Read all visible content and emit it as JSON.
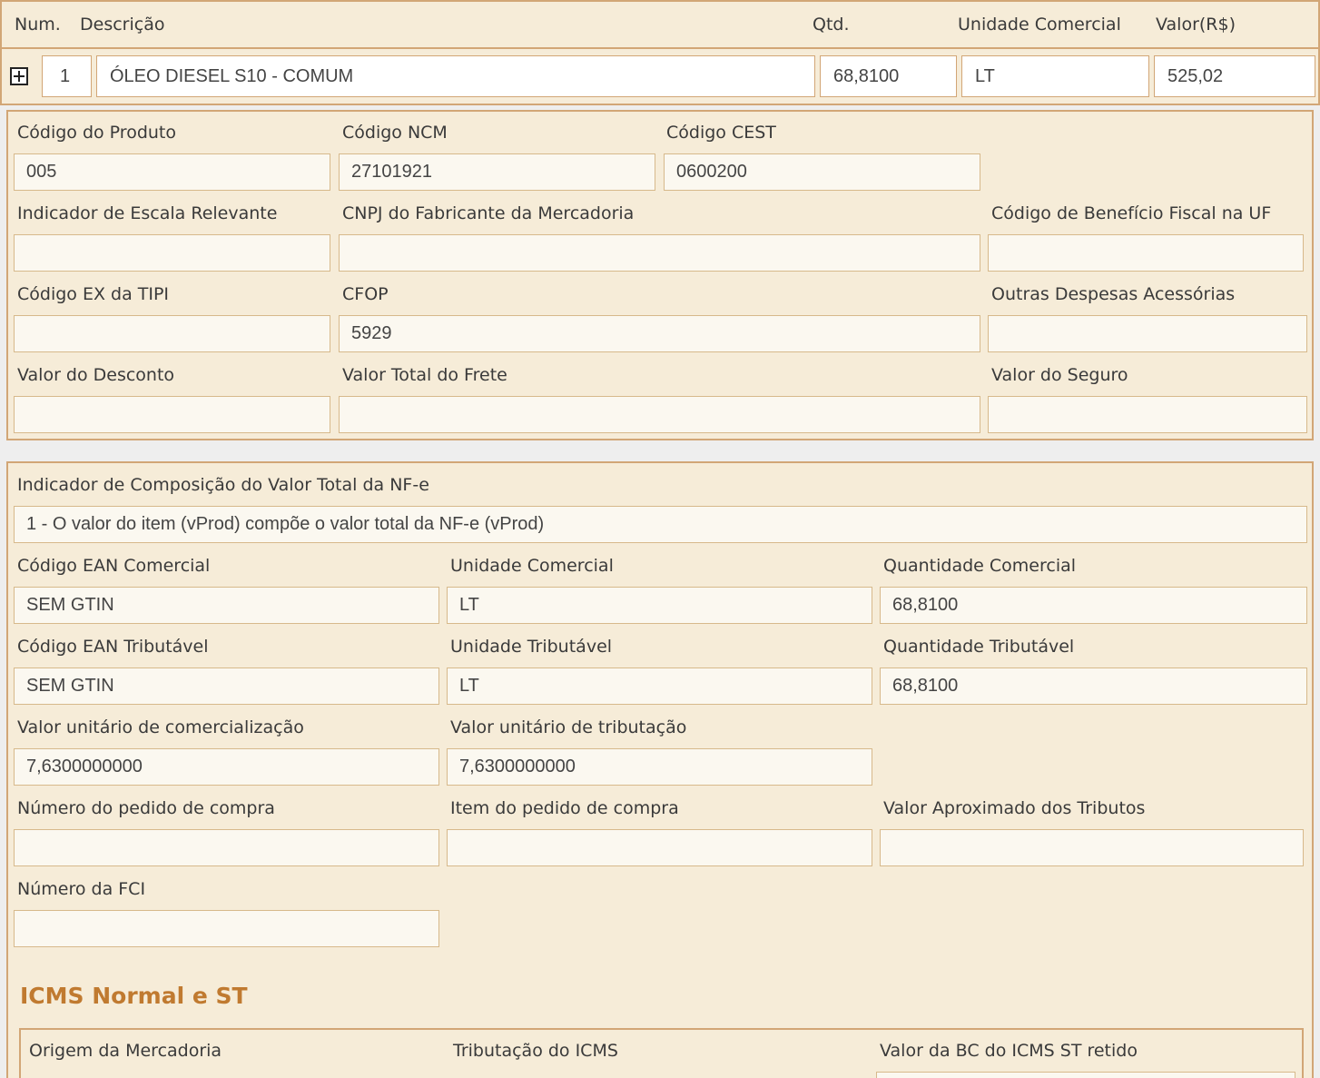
{
  "header": {
    "num": "Num.",
    "descricao": "Descrição",
    "qtd": "Qtd.",
    "unidade_comercial": "Unidade Comercial",
    "valor": "Valor(R$)"
  },
  "item_row": {
    "num": "1",
    "descricao": "ÓLEO DIESEL S10 - COMUM",
    "qtd": "68,8100",
    "unidade": "LT",
    "valor": "525,02"
  },
  "product": {
    "codigo_produto": {
      "label": "Código do Produto",
      "value": "005"
    },
    "codigo_ncm": {
      "label": "Código NCM",
      "value": "27101921"
    },
    "codigo_cest": {
      "label": "Código CEST",
      "value": "0600200"
    },
    "indicador_escala": {
      "label": "Indicador de Escala Relevante",
      "value": ""
    },
    "cnpj_fabricante": {
      "label": "CNPJ do Fabricante da Mercadoria",
      "value": ""
    },
    "codigo_beneficio": {
      "label": "Código de Benefício Fiscal na UF",
      "value": ""
    },
    "codigo_ex_tipi": {
      "label": "Código EX da TIPI",
      "value": ""
    },
    "cfop": {
      "label": "CFOP",
      "value": "5929"
    },
    "outras_despesas": {
      "label": "Outras Despesas Acessórias",
      "value": ""
    },
    "valor_desconto": {
      "label": "Valor do Desconto",
      "value": ""
    },
    "valor_frete": {
      "label": "Valor Total do Frete",
      "value": ""
    },
    "valor_seguro": {
      "label": "Valor do Seguro",
      "value": ""
    }
  },
  "details": {
    "indicador_composicao": {
      "label": "Indicador de Composição do Valor Total da NF-e",
      "value": "1 - O valor do item (vProd) compõe o valor total da NF-e (vProd)"
    },
    "ean_comercial": {
      "label": "Código EAN Comercial",
      "value": "SEM GTIN"
    },
    "unidade_comercial": {
      "label": "Unidade Comercial",
      "value": "LT"
    },
    "quantidade_comercial": {
      "label": "Quantidade Comercial",
      "value": "68,8100"
    },
    "ean_tributavel": {
      "label": "Código EAN Tributável",
      "value": "SEM GTIN"
    },
    "unidade_tributavel": {
      "label": "Unidade Tributável",
      "value": "LT"
    },
    "quantidade_tributavel": {
      "label": "Quantidade Tributável",
      "value": "68,8100"
    },
    "valor_unit_comercializacao": {
      "label": "Valor unitário de comercialização",
      "value": "7,6300000000"
    },
    "valor_unit_tributacao": {
      "label": "Valor unitário de tributação",
      "value": "7,6300000000"
    },
    "numero_pedido": {
      "label": "Número do pedido de compra",
      "value": ""
    },
    "item_pedido": {
      "label": "Item do pedido de compra",
      "value": ""
    },
    "valor_aprox_tributos": {
      "label": "Valor Aproximado dos Tributos",
      "value": ""
    },
    "numero_fci": {
      "label": "Número da FCI",
      "value": ""
    }
  },
  "icms": {
    "title": "ICMS Normal e ST",
    "origem": {
      "label": "Origem da Mercadoria"
    },
    "tributacao": {
      "label": "Tributação do ICMS"
    },
    "valor_bc_st": {
      "label": "Valor da BC do ICMS ST retido"
    }
  },
  "colors": {
    "panel_bg": "#f6ecd8",
    "border": "#d2a676",
    "field_bg": "#fbf8f0",
    "section_title": "#c07a30"
  },
  "icons": {
    "expand": "plus-square-icon"
  }
}
